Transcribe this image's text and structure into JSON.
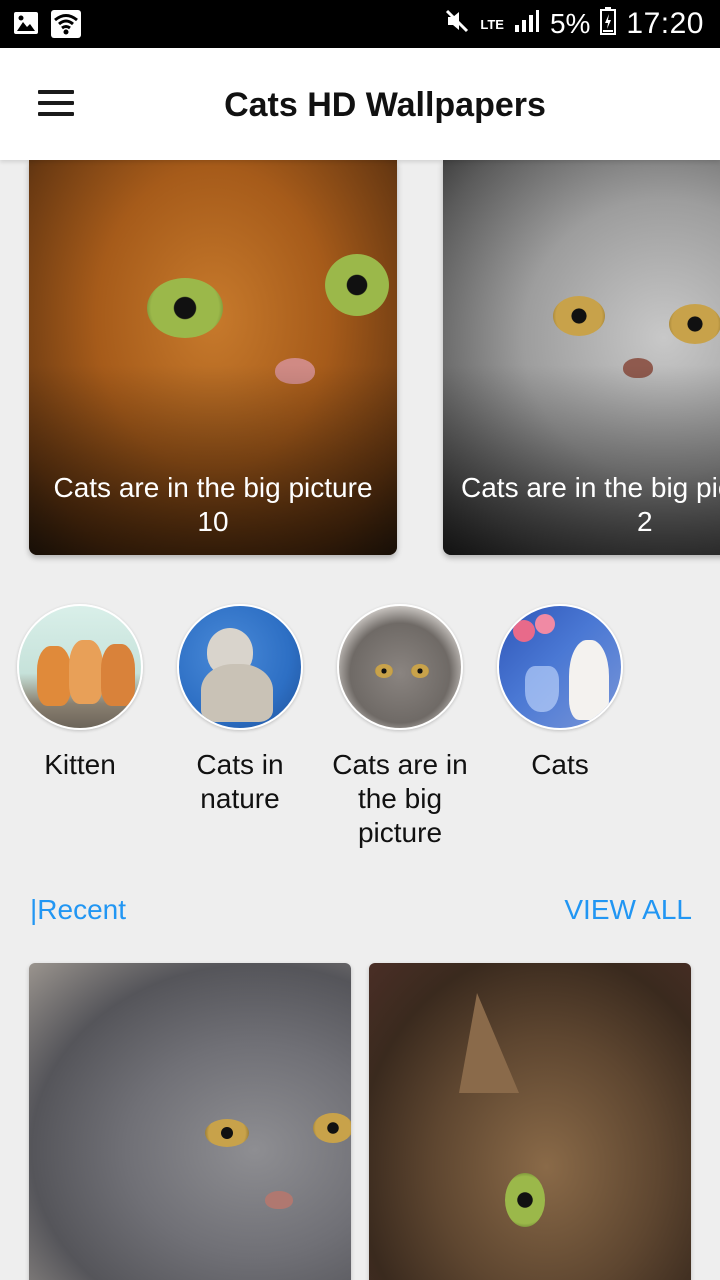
{
  "status_bar": {
    "network": "LTE",
    "battery": "5%",
    "time": "17:20"
  },
  "app_bar": {
    "title": "Cats HD Wallpapers"
  },
  "featured": [
    {
      "caption_line1": "Cats are in the big picture",
      "caption_line2": "10"
    },
    {
      "caption_line1": "Cats are in the big picture",
      "caption_line2": "2"
    }
  ],
  "categories": [
    {
      "label": "Kitten"
    },
    {
      "label": "Cats in nature"
    },
    {
      "label": "Cats are in the big picture"
    },
    {
      "label": "Cats"
    }
  ],
  "recent": {
    "title": "|Recent",
    "view_all": "VIEW ALL"
  },
  "colors": {
    "accent": "#2196f3",
    "status_bar": "#000000",
    "background": "#eeeeee"
  }
}
